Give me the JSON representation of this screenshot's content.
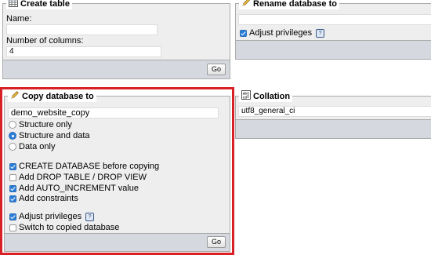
{
  "create_table": {
    "title": "Create table",
    "name_label": "Name:",
    "name_value": "",
    "columns_label": "Number of columns:",
    "columns_value": "4",
    "go_label": "Go"
  },
  "rename_database": {
    "title": "Rename database to",
    "value": "",
    "adjust_privileges_label": "Adjust privileges",
    "adjust_privileges_checked": true,
    "help_glyph": "?"
  },
  "copy_database": {
    "title": "Copy database to",
    "value": "demo_website_copy",
    "options": [
      {
        "label": "Structure only",
        "selected": false
      },
      {
        "label": "Structure and data",
        "selected": true
      },
      {
        "label": "Data only",
        "selected": false
      }
    ],
    "checkboxes": [
      {
        "label": "CREATE DATABASE before copying",
        "checked": true
      },
      {
        "label": "Add DROP TABLE / DROP VIEW",
        "checked": false
      },
      {
        "label": "Add AUTO_INCREMENT value",
        "checked": true
      },
      {
        "label": "Add constraints",
        "checked": true
      }
    ],
    "adjust_privileges_label": "Adjust privileges",
    "switch_label": "Switch to copied database",
    "go_label": "Go",
    "help_glyph": "?"
  },
  "collation": {
    "title": "Collation",
    "value": "utf8_general_ci"
  },
  "colors": {
    "highlight": "#d82027",
    "accent": "#2c7ed6",
    "footer": "#d5d9df",
    "panel": "#eeeeee"
  },
  "icons": {
    "create_table": "table-icon",
    "rename": "pencil-icon",
    "copy": "pencil-icon",
    "collation": "collation-icon"
  }
}
